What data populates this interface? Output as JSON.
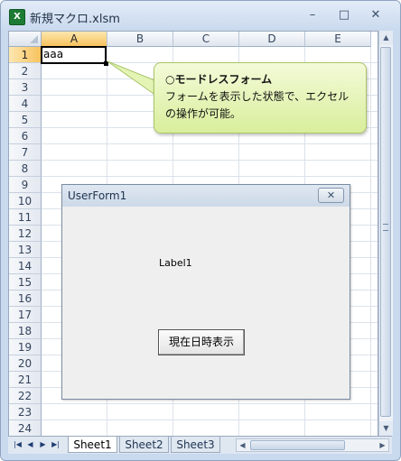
{
  "window": {
    "title": "新規マクロ.xlsm",
    "app_icon_glyph": "X",
    "controls": {
      "minimize": "–",
      "maximize": "□",
      "close": "✕"
    }
  },
  "sheet": {
    "columns": [
      "A",
      "B",
      "C",
      "D",
      "E"
    ],
    "selected_column": "A",
    "rows": [
      "1",
      "2",
      "3",
      "4",
      "5",
      "6",
      "7",
      "8",
      "9",
      "10",
      "11",
      "12",
      "13",
      "14",
      "15",
      "16",
      "17",
      "18",
      "19",
      "20",
      "21",
      "22",
      "23",
      "24"
    ],
    "selected_row": "1",
    "cells": {
      "A1": "aaa"
    }
  },
  "callout": {
    "title": "○モードレスフォーム",
    "body": "フォームを表示した状態で、エクセルの操作が可能。"
  },
  "userform": {
    "title": "UserForm1",
    "close_glyph": "✕",
    "label": "Label1",
    "button_label": "現在日時表示"
  },
  "tabs": {
    "nav": [
      "|◀",
      "◀",
      "▶",
      "▶|"
    ],
    "sheets": [
      "Sheet1",
      "Sheet2",
      "Sheet3"
    ],
    "active": "Sheet1"
  },
  "scrollbar": {
    "up": "▲",
    "down": "▼",
    "left": "◀",
    "right": "▶"
  },
  "colors": {
    "accent": "#f7c25e",
    "window_frame": "#c9d9ee",
    "callout": "#d9ee9c"
  }
}
